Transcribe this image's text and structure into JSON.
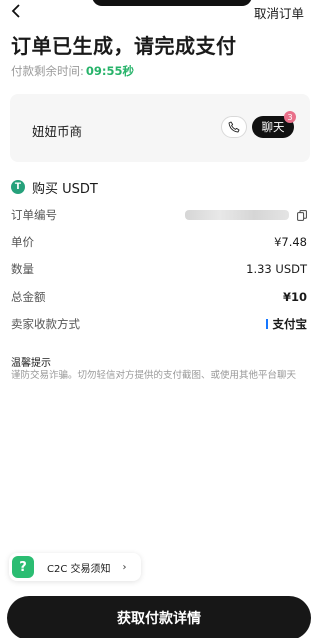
{
  "header": {
    "cancel_label": "取消订单"
  },
  "title": "订单已生成，请完成支付",
  "timer": {
    "label": "付款剩余时间:",
    "time": "09:55秒"
  },
  "merchant": {
    "name": "妞妞币商",
    "chat_label": "聊天",
    "chat_badge": "3"
  },
  "buy": {
    "icon_glyph": "T",
    "label": "购买 USDT"
  },
  "info": {
    "order_no_label": "订单编号",
    "unit_price_label": "单价",
    "unit_price_value": "¥7.48",
    "quantity_label": "数量",
    "quantity_value": "1.33 USDT",
    "total_label": "总金额",
    "total_value": "¥10",
    "pay_method_label": "卖家收款方式",
    "pay_method_value": "支付宝"
  },
  "tips": {
    "title": "温馨提示",
    "text": "谨防交易诈骗。切勿轻信对方提供的支付截图、或使用其他平台聊天"
  },
  "notice": {
    "icon_glyph": "?",
    "label": "C2C 交易须知",
    "chevron": "›"
  },
  "bottom_button": "获取付款详情",
  "colors": {
    "accent_green": "#27b36a",
    "usdt_green": "#26a17b",
    "alipay_blue": "#1677ff",
    "badge_pink": "#e9708a",
    "button_dark": "#171717"
  },
  "icons": [
    "back-arrow-icon",
    "phone-icon",
    "usdt-icon",
    "copy-icon",
    "help-icon",
    "chevron-right-icon"
  ]
}
